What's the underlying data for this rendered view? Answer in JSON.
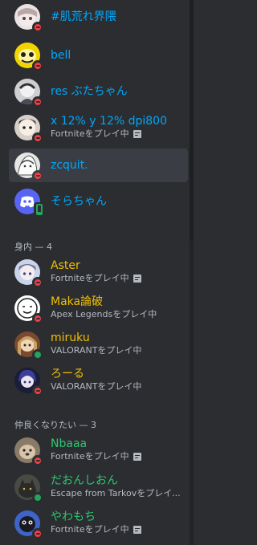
{
  "colors": {
    "background": "#2b2d31",
    "active_row": "#3b3d44",
    "blue_name": "#00a8fc",
    "yellow_name": "#f0c000",
    "green_name": "#2dc770",
    "subtext": "#b5bac1",
    "dnd": "#f23f43",
    "online": "#23a55a"
  },
  "members_top": [
    {
      "name": "#肌荒れ界隈",
      "activity": "",
      "status": "dnd-icon"
    },
    {
      "name": "bell",
      "activity": "",
      "status": "dnd-icon"
    },
    {
      "name": "res ぶたちゃん",
      "activity": "",
      "status": "dnd-icon"
    },
    {
      "name": "x 12% y 12% dpi800",
      "activity": "Fortniteをプレイ中",
      "status": "dnd-icon"
    },
    {
      "name": "zcquit.",
      "activity": "",
      "status": "dnd-icon"
    },
    {
      "name": "そらちゃん",
      "activity": "",
      "status": "mobile-online-icon"
    }
  ],
  "section_family": {
    "label": "身内 — 4",
    "members": [
      {
        "name": "Aster",
        "activity": "Fortniteをプレイ中",
        "status": "dnd-icon"
      },
      {
        "name": "Maka論破",
        "activity": "Apex Legendsをプレイ中",
        "status": "dnd-icon"
      },
      {
        "name": "miruku",
        "activity": "VALORANTをプレイ中",
        "status": "online-icon"
      },
      {
        "name": "ろーる",
        "activity": "VALORANTをプレイ中",
        "status": "dnd-icon"
      }
    ]
  },
  "section_friends": {
    "label": "仲良くなりたい — 3",
    "members": [
      {
        "name": "Nbaaa",
        "activity": "Fortniteをプレイ中",
        "status": "dnd-icon"
      },
      {
        "name": "だおんしおん",
        "activity": "Escape from Tarkovをプレイ...",
        "status": "online-icon"
      },
      {
        "name": "やわもち",
        "activity": "Fortniteをプレイ中",
        "status": "dnd-icon"
      }
    ]
  }
}
